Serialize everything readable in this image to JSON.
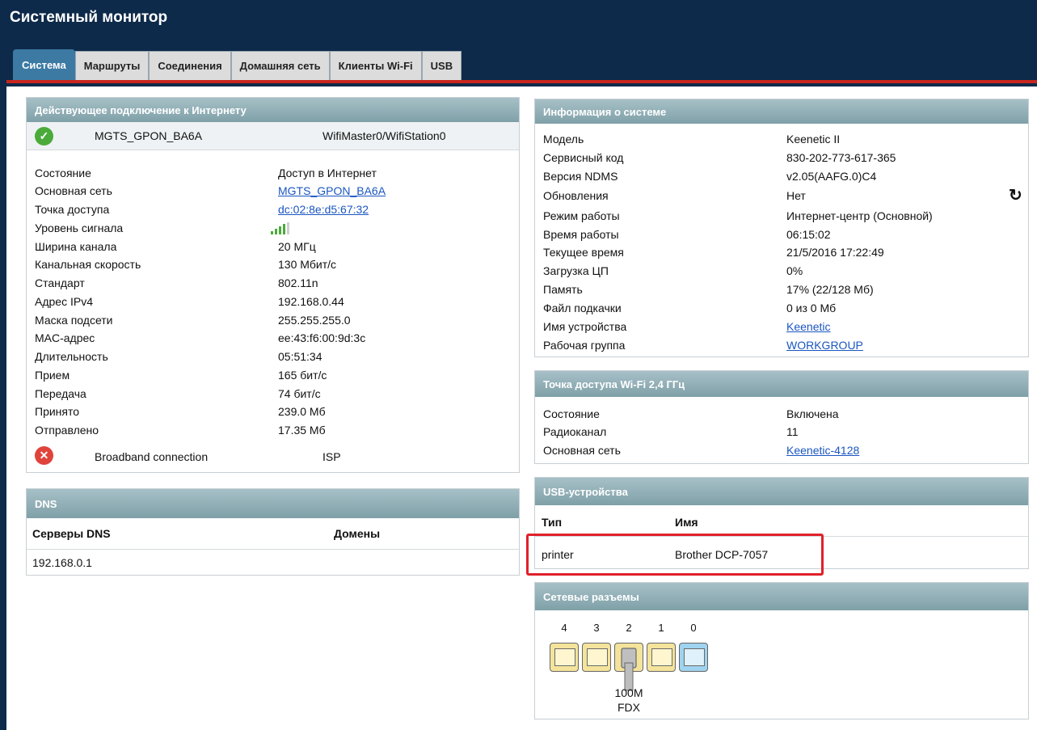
{
  "app": {
    "title": "Системный монитор"
  },
  "tabs": [
    "Система",
    "Маршруты",
    "Соединения",
    "Домашняя сеть",
    "Клиенты Wi-Fi",
    "USB"
  ],
  "internet": {
    "title": "Действующее подключение к Интернету",
    "active": {
      "name": "MGTS_GPON_BA6A",
      "interface": "WifiMaster0/WifiStation0",
      "icon": "check-icon"
    },
    "rows": [
      {
        "label": "Состояние",
        "value": "Доступ в Интернет"
      },
      {
        "label": "Основная сеть",
        "value": "MGTS_GPON_BA6A"
      },
      {
        "label": "Точка доступа",
        "value": "dc:02:8e:d5:67:32"
      },
      {
        "label": "Уровень сигнала",
        "value": ""
      },
      {
        "label": "Ширина канала",
        "value": "20 МГц"
      },
      {
        "label": "Канальная скорость",
        "value": "130 Мбит/с"
      },
      {
        "label": "Стандарт",
        "value": "802.11n"
      },
      {
        "label": "Адрес IPv4",
        "value": "192.168.0.44"
      },
      {
        "label": "Маска подсети",
        "value": "255.255.255.0"
      },
      {
        "label": "MAC-адрес",
        "value": "ee:43:f6:00:9d:3c"
      },
      {
        "label": "Длительность",
        "value": "05:51:34"
      },
      {
        "label": "Прием",
        "value": "165 бит/с"
      },
      {
        "label": "Передача",
        "value": "74 бит/с"
      },
      {
        "label": "Принято",
        "value": "239.0 Мб"
      },
      {
        "label": "Отправлено",
        "value": "17.35 Мб"
      }
    ],
    "signal_level": 0.8,
    "backup": {
      "name": "Broadband connection",
      "interface": "ISP",
      "icon": "error-icon"
    }
  },
  "dns": {
    "title": "DNS",
    "col_servers": "Серверы DNS",
    "col_domains": "Домены",
    "server": "192.168.0.1"
  },
  "sysinfo": {
    "title": "Информация о системе",
    "rows": [
      {
        "label": "Модель",
        "value": "Keenetic II"
      },
      {
        "label": "Сервисный код",
        "value": "830-202-773-617-365"
      },
      {
        "label": "Версия NDMS",
        "value": "v2.05(AAFG.0)C4"
      },
      {
        "label": "Обновления",
        "value": "Нет"
      },
      {
        "label": "Режим работы",
        "value": "Интернет-центр (Основной)"
      },
      {
        "label": "Время работы",
        "value": "06:15:02"
      },
      {
        "label": "Текущее время",
        "value": "21/5/2016 17:22:49"
      },
      {
        "label": "Загрузка ЦП",
        "value": "0%"
      },
      {
        "label": "Память",
        "value": "17% (22/128 Мб)"
      },
      {
        "label": "Файл подкачки",
        "value": "0 из 0 Мб"
      },
      {
        "label": "Имя устройства",
        "value": "Keenetic"
      },
      {
        "label": "Рабочая группа",
        "value": "WORKGROUP"
      }
    ]
  },
  "wifi_ap": {
    "title": "Точка доступа Wi-Fi 2,4 ГГц",
    "rows": [
      {
        "label": "Состояние",
        "value": "Включена"
      },
      {
        "label": "Радиоканал",
        "value": "11"
      },
      {
        "label": "Основная сеть",
        "value": "Keenetic-4128"
      }
    ]
  },
  "usb": {
    "title": "USB-устройства",
    "col_type": "Тип",
    "col_name": "Имя",
    "device": {
      "type": "printer",
      "name": "Brother DCP-7057"
    }
  },
  "ports": {
    "title": "Сетевые разъемы",
    "items": [
      {
        "num": "4",
        "state": "idle",
        "color": "#f4e39b"
      },
      {
        "num": "3",
        "state": "idle",
        "color": "#f4e39b"
      },
      {
        "num": "2",
        "state": "connected",
        "color": "#f4e39b"
      },
      {
        "num": "1",
        "state": "idle",
        "color": "#f4e39b"
      },
      {
        "num": "0",
        "state": "wan",
        "color": "#9fd3ef"
      }
    ],
    "speed": "100M",
    "duplex": "FDX"
  },
  "colors": {
    "header_bg": "#0e2a4a",
    "tab_active": "#3c7aa4",
    "accent_red": "#c9261e",
    "link": "#1a56c0",
    "highlight_box": "#e0202a"
  }
}
